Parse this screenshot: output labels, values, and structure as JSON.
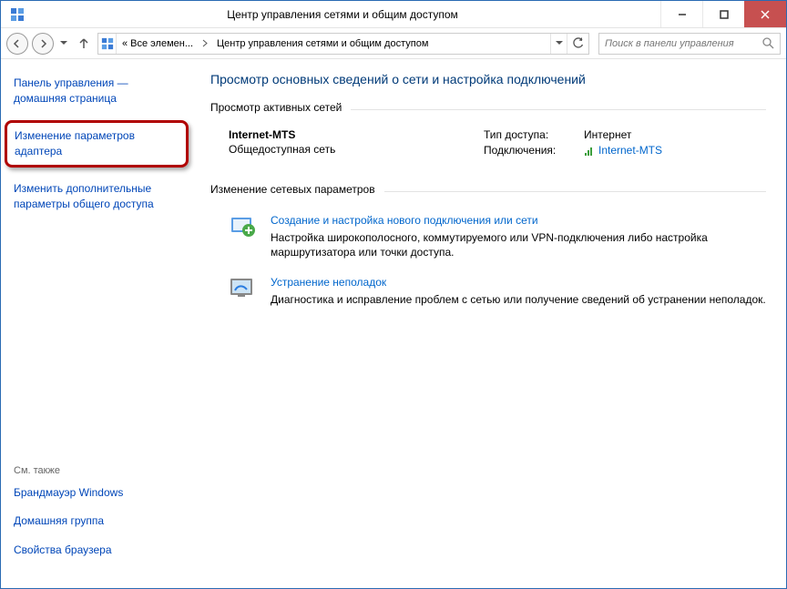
{
  "window": {
    "title": "Центр управления сетями и общим доступом"
  },
  "nav": {
    "breadcrumb_1": "« Все элемен...",
    "breadcrumb_2": "Центр управления сетями и общим доступом",
    "search_placeholder": "Поиск в панели управления"
  },
  "sidebar": {
    "home_line1": "Панель управления —",
    "home_line2": "домашняя страница",
    "adapter_line1": "Изменение параметров адаптера",
    "sharing_line1": "Изменить дополнительные параметры общего доступа",
    "see_also": "См. также",
    "firewall": "Брандмауэр Windows",
    "homegroup": "Домашняя группа",
    "browser": "Свойства браузера"
  },
  "main": {
    "heading": "Просмотр основных сведений о сети и настройка подключений",
    "active_networks_label": "Просмотр активных сетей",
    "network": {
      "name": "Internet-MTS",
      "category": "Общедоступная сеть",
      "access_label": "Тип доступа:",
      "access_value": "Интернет",
      "connections_label": "Подключения:",
      "connections_link": "Internet-MTS"
    },
    "change_settings_label": "Изменение сетевых параметров",
    "item1": {
      "title": "Создание и настройка нового подключения или сети",
      "desc": "Настройка широкополосного, коммутируемого или VPN-подключения либо настройка маршрутизатора или точки доступа."
    },
    "item2": {
      "title": "Устранение неполадок",
      "desc": "Диагностика и исправление проблем с сетью или получение сведений об устранении неполадок."
    }
  }
}
